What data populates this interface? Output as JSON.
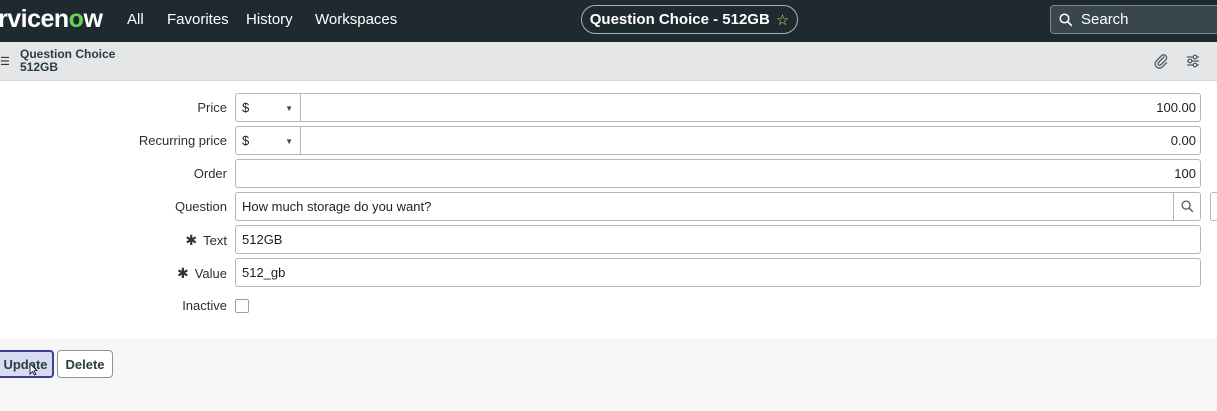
{
  "nav": {
    "logo_main": "rvicen",
    "logo_o": "o",
    "logo_end": "w",
    "links": [
      "All",
      "Favorites",
      "History",
      "Workspaces"
    ],
    "record_pill": "Question Choice - 512GB",
    "star": "☆",
    "search_placeholder": "Search"
  },
  "header": {
    "title_line1": "Question Choice",
    "title_line2": "512GB"
  },
  "form": {
    "price": {
      "label": "Price",
      "currency": "$",
      "amount": "100.00"
    },
    "recurring_price": {
      "label": "Recurring price",
      "currency": "$",
      "amount": "0.00"
    },
    "order": {
      "label": "Order",
      "value": "100"
    },
    "question": {
      "label": "Question",
      "value": "How much storage do you want?"
    },
    "text": {
      "label": "Text",
      "required": "✱",
      "value": "512GB"
    },
    "value": {
      "label": "Value",
      "required": "✱",
      "value": "512_gb"
    },
    "inactive": {
      "label": "Inactive",
      "checked": false
    }
  },
  "buttons": {
    "update": "Update",
    "delete": "Delete"
  },
  "colors": {
    "nav_bg": "#1f2a30",
    "logo_accent": "#62d84e",
    "header_bg": "#e4e6e7",
    "primary_border": "#3b3f8f"
  }
}
